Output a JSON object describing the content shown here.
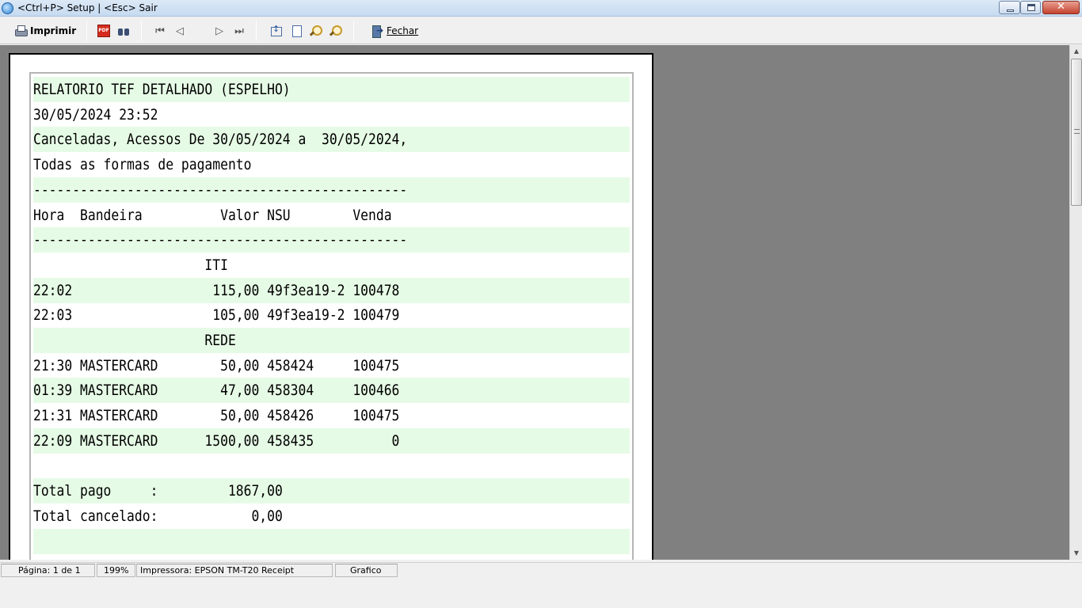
{
  "window": {
    "title": "<Ctrl+P> Setup | <Esc> Sair",
    "close_glyph": "✕"
  },
  "toolbar": {
    "print_label": "Imprimir",
    "pdf_icon_text": "PDF",
    "close_label": "Fechar",
    "nav": {
      "first": "⏮",
      "prev": "◁",
      "next": "▷",
      "last": "⏭"
    }
  },
  "report": {
    "lines": [
      "RELATORIO TEF DETALHADO (ESPELHO)",
      "30/05/2024 23:52",
      "Canceladas, Acessos De 30/05/2024 a  30/05/2024,",
      "Todas as formas de pagamento",
      "------------------------------------------------",
      "Hora  Bandeira          Valor NSU        Venda",
      "------------------------------------------------",
      "                      ITI",
      "22:02                  115,00 49f3ea19-2 100478",
      "22:03                  105,00 49f3ea19-2 100479",
      "                      REDE",
      "21:30 MASTERCARD        50,00 458424     100475",
      "01:39 MASTERCARD        47,00 458304     100466",
      "21:31 MASTERCARD        50,00 458426     100475",
      "22:09 MASTERCARD      1500,00 458435          0",
      "",
      "Total pago     :         1867,00",
      "Total cancelado:            0,00",
      ""
    ]
  },
  "status": {
    "page": "Página: 1 de 1",
    "zoom": "199%",
    "printer": "Impressora: EPSON TM-T20 Receipt",
    "mode": "Grafico"
  },
  "scrollbar": {
    "up": "▲",
    "down": "▼"
  }
}
